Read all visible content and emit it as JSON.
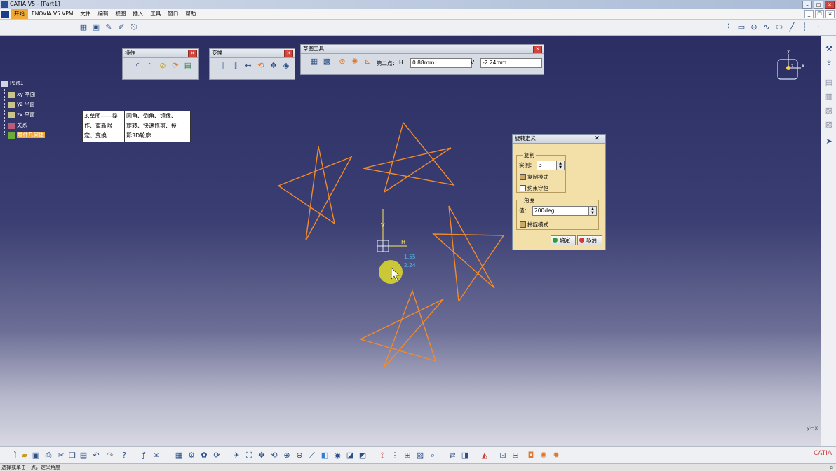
{
  "window": {
    "title": "CATIA V5 - [Part1]"
  },
  "menu": {
    "items": [
      "开始",
      "ENOVIA V5 VPM",
      "文件",
      "编辑",
      "视图",
      "插入",
      "工具",
      "窗口",
      "帮助"
    ]
  },
  "tree": {
    "root": "Part1",
    "items": [
      "xy 平面",
      "yz 平面",
      "zx 平面",
      "关系",
      "零件几何体"
    ]
  },
  "note": {
    "left": [
      "3.草图——操",
      "作、重新限",
      "定、变换"
    ],
    "right": [
      "圆角、倒角、镜像、",
      "旋转、快速修剪、投",
      "影3D轮廓"
    ]
  },
  "panels": {
    "operation": {
      "title": "操作"
    },
    "transform": {
      "title": "变换"
    },
    "sketch_tools": {
      "title": "草图工具",
      "second_point_label": "第二点：",
      "h_label": "H :",
      "h_value": "0.88mm",
      "v_label": "V :",
      "v_value": "-2.24mm"
    }
  },
  "dialog": {
    "title": "旋转定义",
    "copy_group": "复制",
    "instances_label": "实例：",
    "instances_value": "3",
    "duplicate_mode": "复制模式",
    "keep_constraints": "约束守恒",
    "angle_group": "角度",
    "value_label": "值：",
    "value": "200deg",
    "snap_mode": "捕捉模式",
    "ok": "确定",
    "cancel": "取消"
  },
  "viewport": {
    "coord_h": "1.55",
    "coord_v": "2.24",
    "axis_h": "H",
    "axis_v": "V"
  },
  "compass": {
    "x": "x",
    "y": "y",
    "z": "z"
  },
  "status": {
    "text": "选择或单击一点，定义角度"
  },
  "colors": {
    "stars": "#f08a2c",
    "menu_active": "#f0a836",
    "dialog_bg": "#f3dfa8"
  }
}
